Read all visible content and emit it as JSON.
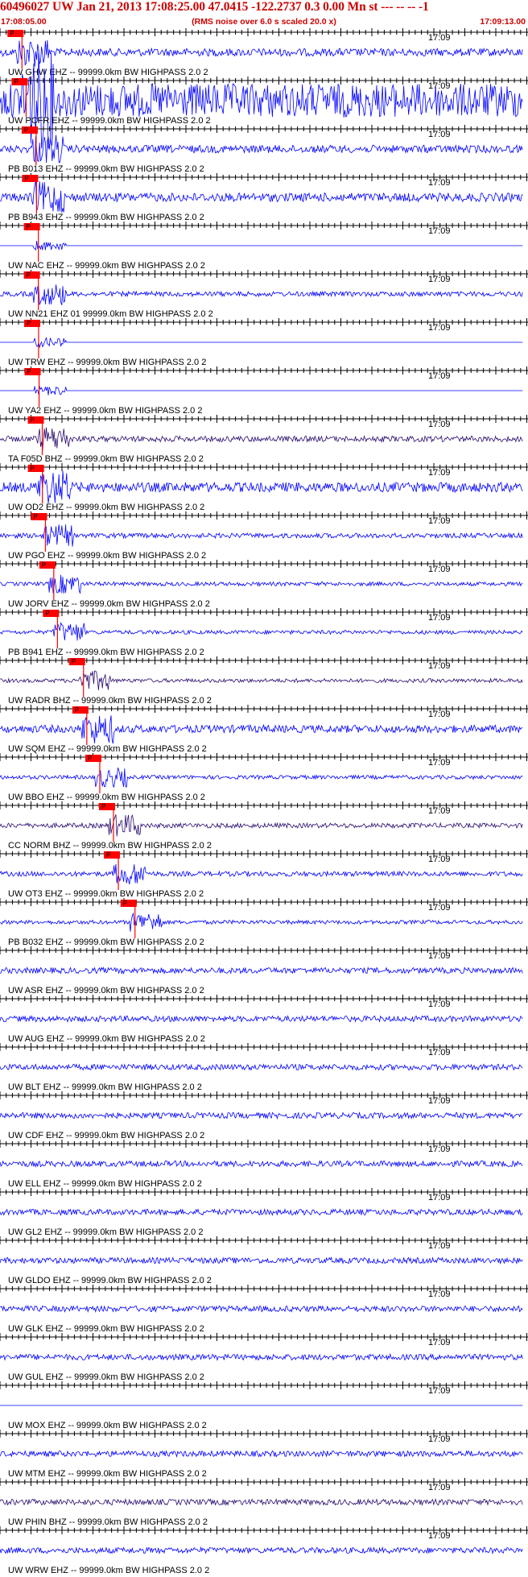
{
  "header": {
    "title": "60496027 UW Jan 21, 2013 17:08:25.00   47.0415 -122.2737  0.3 0.00 Mn st --- -- --   -1",
    "start_time": "17:08:05.00",
    "end_time": "17:09:13.00",
    "subtitle": "(RMS noise over 6.0 s scaled 20.0 x)"
  },
  "colors": {
    "trace": "#0000ff",
    "trace_dark": "#2a0a6e",
    "pick_box": "#ff0000",
    "pick_line": "#ff0000",
    "text_red": "#cc0000",
    "axis": "#000000"
  },
  "chart_data": {
    "type": "line",
    "title": "60496027 UW Jan 21, 2013 17:08:25.00   47.0415 -122.2737  0.3 0.00 Mn st --- -- --   -1",
    "subtitle": "(RMS noise over 6.0 s scaled 20.0 x)",
    "x_start": "17:08:05.00",
    "x_end": "17:09:13.00",
    "time_tick_label": "17:09",
    "pick_label": "P",
    "series": [
      {
        "name": "UW GHW EHZ -- 99999.0km BW  HIGHPASS  2.0  2",
        "pick": 14.0,
        "pick2": 14.6,
        "amp": 0.16
      },
      {
        "name": "UW PCFR EHZ -- 99999.0km BW  HIGHPASS  2.0  2",
        "pick": 17.4,
        "pick2": 18.4,
        "amp": 0.7
      },
      {
        "name": "PB B013 EHZ -- 99999.0km BW  HIGHPASS  2.0  2",
        "pick": 25.6,
        "amp": 0.16
      },
      {
        "name": "PB B943 EHZ -- 99999.0km BW  HIGHPASS  2.0  2",
        "pick": 25.9,
        "amp": 0.18
      },
      {
        "name": "UW NAC EHZ -- 99999.0km BW  HIGHPASS  2.0  2",
        "pick": 27.4,
        "amp": 0.0
      },
      {
        "name": "UW NN21 EHZ 01 99999.0km BW  HIGHPASS  2.0  2",
        "pick": 27.4,
        "amp": 0.1
      },
      {
        "name": "UW TRW EHZ -- 99999.0km BW  HIGHPASS  2.0  2",
        "pick": 27.6,
        "amp": 0.0
      },
      {
        "name": "UW YA2 EHZ -- 99999.0km BW  HIGHPASS  2.0  2",
        "pick": 28.0,
        "amp": 0.0
      },
      {
        "name": "TA F05D BHZ -- 99999.0km BW  HIGHPASS  2.0  2",
        "pick": 30.6,
        "amp": 0.12
      },
      {
        "name": "UW OD2 EHZ -- 99999.0km BW  HIGHPASS  2.0  2",
        "pick": 30.7,
        "amp": 0.2
      },
      {
        "name": "UW PGO EHZ -- 99999.0km BW  HIGHPASS  2.0  2",
        "pick": 33.2,
        "amp": 0.1
      },
      {
        "name": "UW JORV EHZ -- 99999.0km BW  HIGHPASS  2.0  2",
        "pick": 40.0,
        "amp": 0.08
      },
      {
        "name": "PB B941 EHZ -- 99999.0km BW  HIGHPASS  2.0  2",
        "pick": 43.0,
        "amp": 0.08
      },
      {
        "name": "UW RADR BHZ -- 99999.0km BW  HIGHPASS  2.0  2",
        "pick": 64.3,
        "amp": 0.08
      },
      {
        "name": "UW SQM EHZ -- 99999.0km BW  HIGHPASS  2.0  2",
        "pick": 67.0,
        "pick2": 70.0,
        "amp": 0.16
      },
      {
        "name": "UW BBO EHZ -- 99999.0km BW  HIGHPASS  2.0  2",
        "pick": 77.6,
        "pick2": 79.6,
        "amp": 0.08
      },
      {
        "name": "CC NORM BHZ -- 99999.0km BW  HIGHPASS  2.0  2",
        "pick": 88.8,
        "amp": 0.1
      },
      {
        "name": "UW OT3 EHZ -- 99999.0km BW  HIGHPASS  2.0  2",
        "pick": 92.8,
        "amp": 0.1
      },
      {
        "name": "PB B032 EHZ -- 99999.0km BW  HIGHPASS  2.0  2",
        "pick": 106.4,
        "amp": 0.08
      },
      {
        "name": "UW ASR EHZ -- 99999.0km BW  HIGHPASS  2.0  2",
        "amp": 0.12
      },
      {
        "name": "UW AUG EHZ -- 99999.0km BW  HIGHPASS  2.0  2",
        "amp": 0.12
      },
      {
        "name": "UW BLT EHZ -- 99999.0km BW  HIGHPASS  2.0  2",
        "amp": 0.12
      },
      {
        "name": "UW CDF EHZ -- 99999.0km BW  HIGHPASS  2.0  2",
        "amp": 0.12
      },
      {
        "name": "UW ELL EHZ -- 99999.0km BW  HIGHPASS  2.0  2",
        "amp": 0.12
      },
      {
        "name": "UW GL2 EHZ -- 99999.0km BW  HIGHPASS  2.0  2",
        "amp": 0.12
      },
      {
        "name": "UW GLDO EHZ -- 99999.0km BW  HIGHPASS  2.0  2",
        "amp": 0.12
      },
      {
        "name": "UW GLK EHZ -- 99999.0km BW  HIGHPASS  2.0  2",
        "amp": 0.12
      },
      {
        "name": "UW GUL EHZ -- 99999.0km BW  HIGHPASS  2.0  2",
        "amp": 0.12
      },
      {
        "name": "UW MOX EHZ -- 99999.0km BW  HIGHPASS  2.0  2",
        "amp": 0.0
      },
      {
        "name": "UW MTM EHZ -- 99999.0km BW  HIGHPASS  2.0  2",
        "amp": 0.12
      },
      {
        "name": "UW PHIN BHZ -- 99999.0km BW  HIGHPASS  2.0  2",
        "amp": 0.12
      },
      {
        "name": "UW WRW EHZ -- 99999.0km BW  HIGHPASS  2.0  2",
        "amp": 0.12
      }
    ]
  }
}
